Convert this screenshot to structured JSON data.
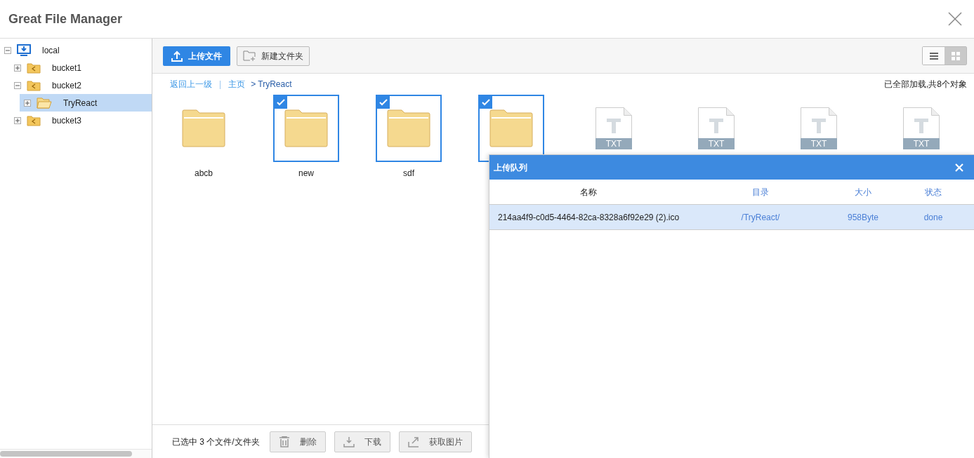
{
  "window": {
    "title": "Great File Manager"
  },
  "tree": [
    {
      "label": "local",
      "kind": "drive",
      "expanded": true,
      "selected": false,
      "children": [
        {
          "label": "bucket1",
          "kind": "shared",
          "expanded": false,
          "selected": false
        },
        {
          "label": "bucket2",
          "kind": "shared",
          "expanded": true,
          "selected": false,
          "children": [
            {
              "label": "TryReact",
              "kind": "folder",
              "expanded": false,
              "selected": true
            }
          ]
        },
        {
          "label": "bucket3",
          "kind": "shared",
          "expanded": false,
          "selected": false
        }
      ]
    }
  ],
  "toolbar": {
    "upload": "上传文件",
    "new_folder": "新建文件夹",
    "views": [
      {
        "kind": "list",
        "selected": false
      },
      {
        "kind": "grid",
        "selected": true
      }
    ]
  },
  "breadcrumb": {
    "back": "返回上一级",
    "separator": "|",
    "home": "主页",
    "current": "> TryReact"
  },
  "load_status": "已全部加载,共8个对象",
  "items": [
    {
      "kind": "folder",
      "name": "abcb",
      "selected": false
    },
    {
      "kind": "folder",
      "name": "new",
      "selected": true
    },
    {
      "kind": "folder",
      "name": "sdf",
      "selected": true
    },
    {
      "kind": "folder",
      "selected": true
    },
    {
      "kind": "txt",
      "badge": "TXT",
      "selected": false
    },
    {
      "kind": "txt",
      "badge": "TXT",
      "selected": false
    },
    {
      "kind": "txt",
      "badge": "TXT",
      "selected": false
    },
    {
      "kind": "txt",
      "badge": "TXT",
      "selected": false
    }
  ],
  "footer": {
    "selection": "已选中 3 个文件/文件夹",
    "buttons": [
      {
        "kind": "delete",
        "label": "删除"
      },
      {
        "kind": "download",
        "label": "下载"
      },
      {
        "kind": "image",
        "label": "获取图片"
      }
    ]
  },
  "upload_queue": {
    "title": "上传队列",
    "columns": [
      "名称",
      "目录",
      "大小",
      "状态"
    ],
    "rows": [
      {
        "name": "214aa4f9-c0d5-4464-82ca-8328a6f92e29 (2).ico",
        "dir": "/TryReact/",
        "size": "958Byte",
        "status": "done",
        "selected": true
      }
    ]
  }
}
